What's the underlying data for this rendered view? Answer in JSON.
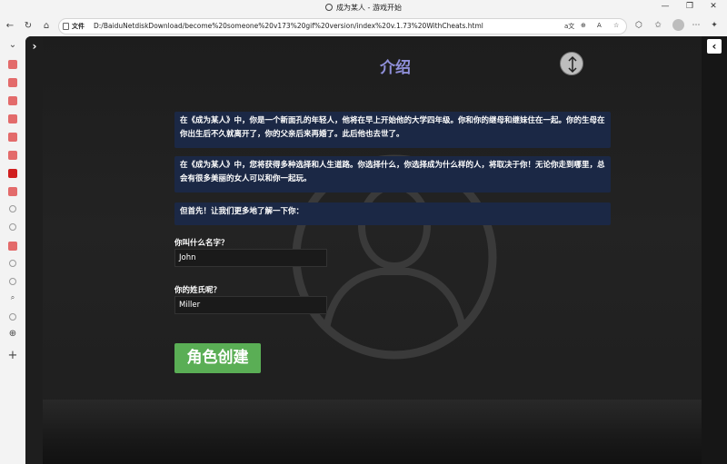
{
  "window": {
    "title": "成为某人 - 游戏开始"
  },
  "browser": {
    "url_label": "文件",
    "url": "D:/BaiduNetdiskDownload/become%20someone%20v173%20gif%20version/index%20v.1.73%20WithCheats.html",
    "read_aloud": "A",
    "translate": "a文"
  },
  "game": {
    "page_title": "介绍",
    "paragraphs": [
      "在《成为某人》中，你是一个新面孔的年轻人，他将在早上开始他的大学四年级。你和你的继母和继妹住在一起。你的生母在你出生后不久就离开了，你的父亲后来再婚了。此后他也去世了。",
      "在《成为某人》中，您将获得多种选择和人生道路。你选择什么，你选择成为什么样的人，将取决于你！无论你走到哪里，总会有很多美丽的女人可以和你一起玩。",
      "但首先！让我们更多地了解一下你："
    ],
    "first_name_label": "你叫什么名字？",
    "first_name_value": "John",
    "last_name_label": "你的姓氏呢？",
    "last_name_value": "Miller",
    "create_button": "角色创建"
  },
  "colors": {
    "title_color": "#8f8fd9",
    "box_bg": "#1b2845",
    "button_bg": "#5aae55"
  }
}
